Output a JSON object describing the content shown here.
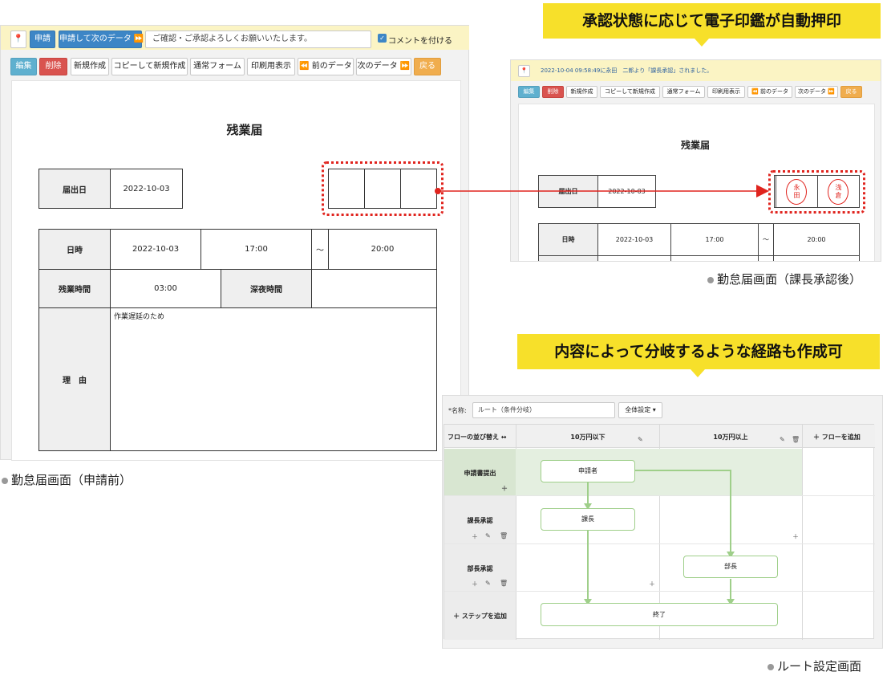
{
  "screen1": {
    "toolbar": {
      "apply_label": "申請",
      "apply_next_label": "申請して次のデータ ⏩",
      "comment_value": "ご確認・ご承認よろしくお願いいたします。",
      "comment_checkbox_label": "コメントを付ける"
    },
    "actions": [
      "編集",
      "削除",
      "新規作成",
      "コピーして新規作成",
      "通常フォーム",
      "印刷用表示",
      "⏪ 前のデータ",
      "次のデータ ⏩",
      "戻る"
    ],
    "form": {
      "title": "残業届",
      "submit_date_label": "届出日",
      "submit_date_value": "2022-10-03",
      "datetime_label": "日時",
      "date_value": "2022-10-03",
      "start_time": "17:00",
      "tilde": "〜",
      "end_time": "20:00",
      "overtime_label": "残業時間",
      "overtime_value": "03:00",
      "late_night_label": "深夜時間",
      "late_night_value": "",
      "reason_label": "理　由",
      "reason_value": "作業遅延のため"
    },
    "caption": "勤怠届画面（申請前）"
  },
  "screen2": {
    "notice": "2022-10-04 09:58:49に永田　二郎より「課長承認」されました。",
    "actions": [
      "編集",
      "削除",
      "新規作成",
      "コピーして新規作成",
      "通常フォーム",
      "印刷用表示",
      "⏪ 前のデータ",
      "次のデータ ⏩",
      "戻る"
    ],
    "form": {
      "title": "残業届",
      "submit_date_label": "届出日",
      "submit_date_value": "2022-10-03",
      "datetime_label": "日時",
      "date_value": "2022-10-03",
      "start_time": "17:00",
      "tilde": "〜",
      "end_time": "20:00"
    },
    "stamps": [
      "永\n田",
      "浅\n倉"
    ],
    "caption": "勤怠届画面（課長承認後）"
  },
  "callouts": {
    "stamp": "承認状態に応じて電子印鑑が自動押印",
    "route": "内容によって分岐するような経路も作成可"
  },
  "route": {
    "name_label": "*名称:",
    "name_value": "ルート（条件分岐）",
    "settings_label": "全体設定 ▾",
    "header": {
      "sort_label": "フローの並び替え ↔",
      "col1": "10万円以下",
      "col2": "10万円以上",
      "add_flow": "＋ フローを追加"
    },
    "steps": [
      "申請書提出",
      "課長承認",
      "部長承認"
    ],
    "add_step": "＋ ステップを追加",
    "nodes": {
      "applicant": "申請者",
      "section_chief": "課長",
      "dept_head": "部長",
      "end": "終了"
    },
    "caption": "ルート設定画面"
  },
  "colors": {
    "callout": "#f7e02a",
    "stamp_red": "#e0241e",
    "flow_green": "#9fcf8a",
    "highlight_row": "#e4efe0"
  }
}
